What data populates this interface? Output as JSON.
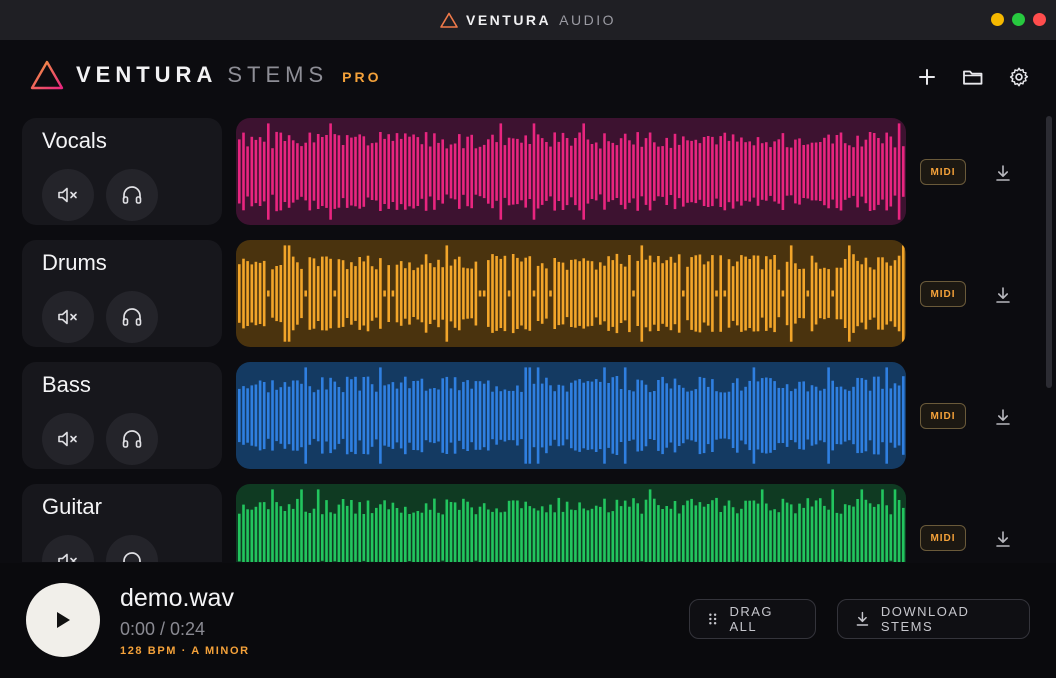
{
  "titlebar": {
    "brand_strong": "VENTURA",
    "brand_light": "AUDIO",
    "traffic_colors": [
      "#f5b800",
      "#27c93f",
      "#ff4d4d"
    ]
  },
  "header": {
    "logo_strong": "VENTURA",
    "logo_light": "STEMS",
    "logo_pro": "PRO",
    "actions": [
      "plus-icon",
      "folder-icon",
      "gear-icon"
    ]
  },
  "stems": [
    {
      "name": "Vocals",
      "color": "#e8257f",
      "bg": "#3d1230",
      "midi_label": "MIDI"
    },
    {
      "name": "Drums",
      "color": "#f2a52a",
      "bg": "#4a330e",
      "midi_label": "MIDI"
    },
    {
      "name": "Bass",
      "color": "#2f7fe0",
      "bg": "#143a62",
      "midi_label": "MIDI"
    },
    {
      "name": "Guitar",
      "color": "#22c55e",
      "bg": "#0f3a22",
      "midi_label": "MIDI"
    }
  ],
  "player": {
    "file_name": "demo.wav",
    "time": "0:00 / 0:24",
    "meta": "128 BPM · A MINOR",
    "drag_all_label": "DRAG ALL",
    "download_label": "DOWNLOAD STEMS"
  },
  "accent": "#f5a23a"
}
